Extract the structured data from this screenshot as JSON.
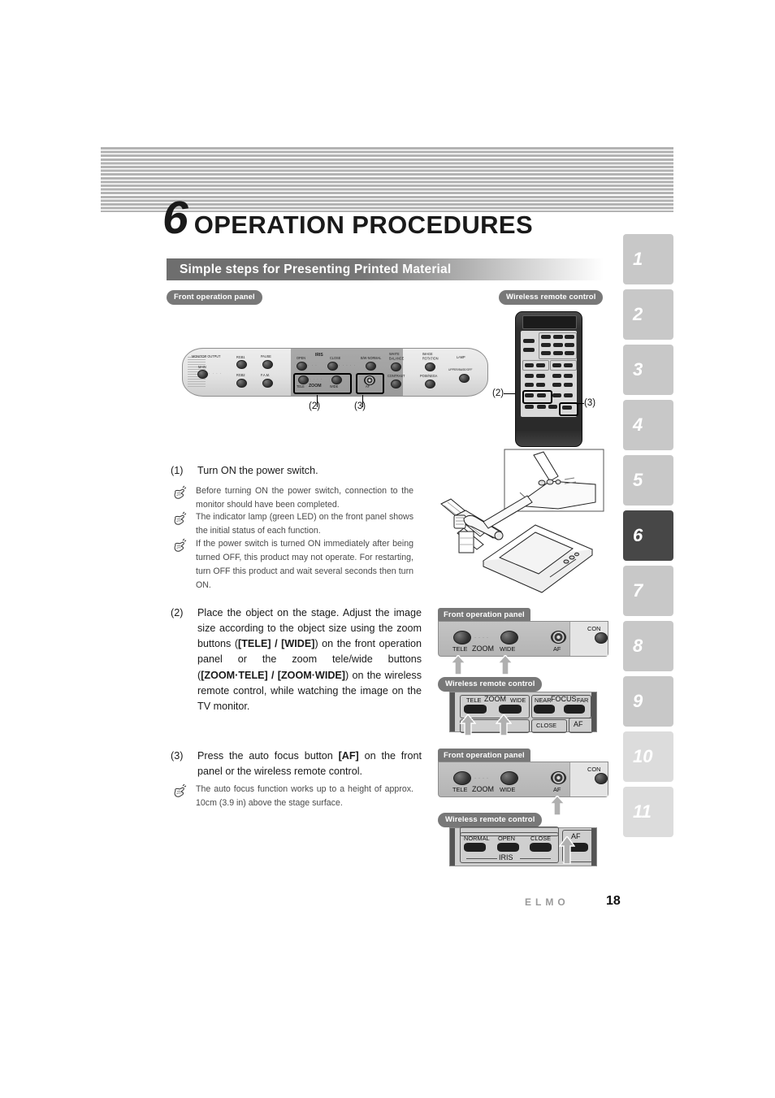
{
  "chapter": {
    "number": "6",
    "title": "OPERATION PROCEDURES"
  },
  "section": {
    "heading": "Simple steps for Presenting Printed Material"
  },
  "badges": {
    "front_operation_panel": "Front operation panel",
    "wireless_remote_control": "Wireless remote control"
  },
  "front_panel": {
    "labels": {
      "monitor_output": "MONITOR OUTPUT",
      "main": "MAIN",
      "rgb1": "RGB1",
      "rgb2": "RGB2",
      "pause": "PAUSE",
      "fam": "F.A.M.",
      "iris": "IRIS",
      "open": "OPEN",
      "close": "CLOSE",
      "bw_normal": "B/W·NORMAL",
      "tele": "TELE",
      "zoom": "ZOOM",
      "wide": "WIDE",
      "af": "AF",
      "white_balance": "WHITE\nBALANCE",
      "contrast": "CONTRAST",
      "image_rotation": "IMAGE\nROTATION",
      "posi_nega": "POSI/NEGA",
      "lamp": "LAMP",
      "upper_base_off": "UPPER/BASE/OFF"
    },
    "callouts": {
      "zoom_ref": "(2)",
      "af_ref": "(3)"
    }
  },
  "remote_panel": {
    "callouts": {
      "zoom_ref": "(2)",
      "af_ref": "(3)"
    }
  },
  "steps": [
    {
      "number": "(1)",
      "text": "Turn ON the power switch.",
      "notes": [
        "Before turning ON the power switch, connection to the monitor should have been completed.",
        "The indicator lamp (green LED) on the front panel shows the initial status of each function.",
        "If the power switch is turned ON immediately after being turned OFF, this product may not operate. For restarting, turn OFF this product and wait several seconds then turn ON."
      ]
    },
    {
      "number": "(2)",
      "text_parts": [
        {
          "t": "Place the object on the stage. Adjust the image size according to the object size using the zoom buttons (",
          "b": false
        },
        {
          "t": "[TELE] / [WIDE]",
          "b": true
        },
        {
          "t": ") on the front operation panel or the zoom tele/wide buttons (",
          "b": false
        },
        {
          "t": "[ZOOM·TELE] / [ZOOM·WIDE]",
          "b": true
        },
        {
          "t": ") on the wireless remote control, while watching the image on the TV monitor.",
          "b": false
        }
      ],
      "notes": []
    },
    {
      "number": "(3)",
      "text_parts": [
        {
          "t": "Press the auto focus button ",
          "b": false
        },
        {
          "t": "[AF]",
          "b": true
        },
        {
          "t": " on the front panel or the wireless remote control.",
          "b": false
        }
      ],
      "notes": [
        "The auto focus function works up to a height of approx. 10cm (3.9 in) above the stage surface."
      ]
    }
  ],
  "detail_zoom": {
    "front_panel_badge": "Front operation panel",
    "remote_badge": "Wireless remote control",
    "front_labels": {
      "tele": "TELE",
      "zoom": "ZOOM",
      "wide": "WIDE",
      "af": "AF",
      "contrast_partial": "CON"
    },
    "remote_labels": {
      "tele": "TELE",
      "zoom": "ZOOM",
      "wide": "WIDE",
      "near": "NEAR",
      "focus": "FOCUS",
      "far": "FAR",
      "close": "CLOSE",
      "af": "AF"
    }
  },
  "detail_af": {
    "front_panel_badge": "Front operation panel",
    "remote_badge": "Wireless remote control",
    "front_labels": {
      "tele": "TELE",
      "zoom": "ZOOM",
      "wide": "WIDE",
      "af": "AF",
      "contrast_partial": "CON"
    },
    "remote_labels": {
      "normal": "NORMAL",
      "open": "OPEN",
      "close": "CLOSE",
      "iris": "IRIS",
      "af": "AF"
    }
  },
  "side_tabs": [
    {
      "label": "1",
      "state": "normal"
    },
    {
      "label": "2",
      "state": "normal"
    },
    {
      "label": "3",
      "state": "normal"
    },
    {
      "label": "4",
      "state": "normal"
    },
    {
      "label": "5",
      "state": "normal"
    },
    {
      "label": "6",
      "state": "active"
    },
    {
      "label": "7",
      "state": "normal"
    },
    {
      "label": "8",
      "state": "normal"
    },
    {
      "label": "9",
      "state": "normal"
    },
    {
      "label": "10",
      "state": "faint"
    },
    {
      "label": "11",
      "state": "faint"
    }
  ],
  "footer": {
    "brand": "ELMO",
    "page_number": "18"
  },
  "colors": {
    "accent_dark": "#474747",
    "tab_gray": "#c8c8c8",
    "bar_gray": "#6e6e6e"
  }
}
